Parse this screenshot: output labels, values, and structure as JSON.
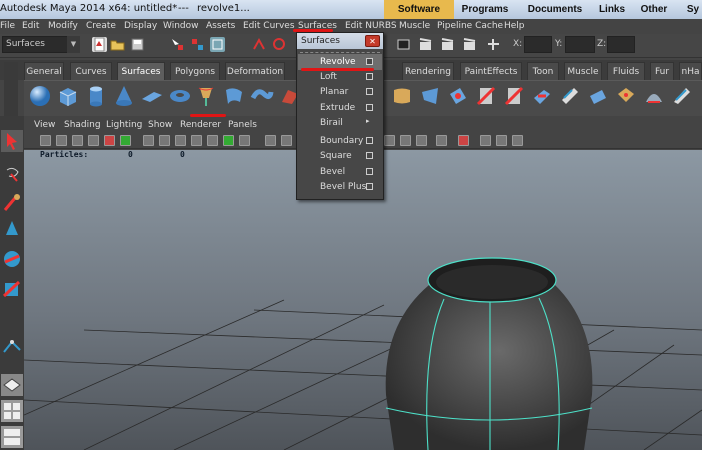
{
  "window": {
    "title": "Autodesk Maya 2014 x64: untitled*",
    "separator": "---",
    "document": "revolve1..."
  },
  "site_nav": [
    "Software",
    "Programs",
    "Documents",
    "Links",
    "Other",
    "Sy"
  ],
  "menubar": [
    "File",
    "Edit",
    "Modify",
    "Create",
    "Display",
    "Window",
    "Assets",
    "Edit Curves",
    "Surfaces",
    "Edit NURBS",
    "Muscle",
    "Pipeline Cache",
    "Help"
  ],
  "status_line": {
    "menu_set": "Surfaces",
    "coord_labels": [
      "X:",
      "Y:",
      "Z:"
    ]
  },
  "shelf_tabs": [
    "General",
    "Curves",
    "Surfaces",
    "Polygons",
    "Deformation",
    "Rendering",
    "PaintEffects",
    "Toon",
    "Muscle",
    "Fluids",
    "Fur",
    "nHa"
  ],
  "shelf_active_tab": "Surfaces",
  "panel_menus": [
    "View",
    "Shading",
    "Lighting",
    "Show",
    "Renderer",
    "Panels"
  ],
  "viewport": {
    "particles_label": "Particles:",
    "particles_values": [
      "0",
      "0"
    ]
  },
  "surfaces_menu": {
    "title": "Surfaces",
    "close_icon": "close-icon",
    "items": [
      {
        "label": "Revolve",
        "option_box": true,
        "submenu": false,
        "highlighted": true
      },
      {
        "label": "Loft",
        "option_box": true,
        "submenu": false,
        "highlighted": false
      },
      {
        "label": "Planar",
        "option_box": true,
        "submenu": false,
        "highlighted": false
      },
      {
        "label": "Extrude",
        "option_box": true,
        "submenu": false,
        "highlighted": false
      },
      {
        "label": "Birail",
        "option_box": false,
        "submenu": true,
        "highlighted": false
      },
      {
        "label": "Boundary",
        "option_box": true,
        "submenu": false,
        "highlighted": false
      },
      {
        "label": "Square",
        "option_box": true,
        "submenu": false,
        "highlighted": false
      },
      {
        "label": "Bevel",
        "option_box": true,
        "submenu": false,
        "highlighted": false
      },
      {
        "label": "Bevel Plus",
        "option_box": true,
        "submenu": false,
        "highlighted": false
      }
    ]
  },
  "colors": {
    "accent_orange": "#e8b94d",
    "annotation_red": "#e01515",
    "wireframe": "#4de0c8"
  }
}
